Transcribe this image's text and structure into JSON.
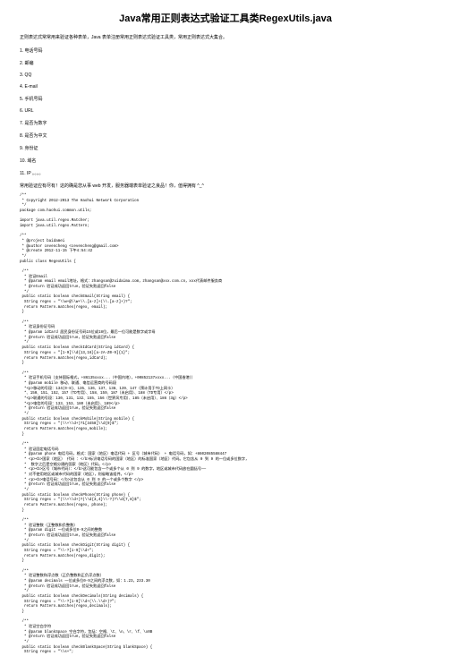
{
  "title": "Java常用正则表达式验证工具类RegexUtils.java",
  "intro": "正则表达式常常用来验证各种表单，Java 表单注册常用正则表达式验证工具类，常用正则表达式大集合。",
  "list": [
    "1. 电话号码",
    "2. 邮编",
    "3. QQ",
    "4. E-mail",
    "5. 手机号码",
    "6. URL",
    "7. 是否为数字",
    "8. 是否为中文",
    "9. 身份证",
    "10. 域名",
    "11. IP 。。。。"
  ],
  "note": "常用验证应有尽有！这的确是您从事 web 开发，服务器端表单验证之良品！你，值得拥有 ^_^",
  "code": "/**\n * Copyright 2012-2013 The Haohui Network Corporation\n */\npackage com.haohui.common.utils;\n\nimport java.util.regex.Matcher;\nimport java.util.regex.Pattern;\n\n/**\n * @project baidamei\n * @author cevencheng <cevencheng@gmail.com>\n * @create 2012-11-15 下午4:54:42\n */\npublic class RegexUtils {\n\n /**\n  * 验证Email\n  * @param email email地址，格式：zhangsan@zuidaima.com，zhangsan@xxx.com.cn，xxx代表邮件服务商\n  * @return 验证成功返回true，验证失败返回false\n  */\n public static boolean checkEmail(String email) {\n  String regex = \"\\\\w+@\\\\w+\\\\.[a-z]+(\\\\.[a-z]+)?\";\n  return Pattern.matches(regex, email);\n }\n\n /**\n  * 验证身份证号码\n  * @param idCard 居民身份证号码15位或18位，最后一位可能是数字或字母\n  * @return 验证成功返回true，验证失败返回false\n  */\n public static boolean checkIdCard(String idCard) {\n  String regex = \"[1-9]\\\\d{13,16}[a-zA-Z0-9]{1}\";\n  return Pattern.matches(regex,idCard);\n }\n\n /**\n  * 验证手机号码（支持国际格式，+86135xxxx...（中国内地），+00852137xxxx...（中国香港））\n  * @param mobile 移动、联通、电信运营商的号码段\n  *<p>移动的号段：134(0-8)、135、136、137、138、139、147（预计用于TD上网卡）\n  *、150、151、152、157（TD专用）、158、159、187（未启用）、188（TD专用）</p>\n  *<p>联通的号段：130、131、132、155、156（世界风专用）、185（未启用）、186（3g）</p>\n  *<p>电信的号段：133、153、180（未启用）、189</p>\n  * @return 验证成功返回true，验证失败返回false\n  */\n public static boolean checkMobile(String mobile) {\n  String regex = \"(\\\\+\\\\d+)?1[3458]\\\\d{9}$\";\n  return Pattern.matches(regex,mobile);\n }\n\n /**\n  * 验证固定电话号码\n  * @param phone 电话号码，格式：国家（地区）电话代码 + 区号（城市代码） + 电话号码，如：+8602085588447\n  * <p><b>国家（地区） 代码 ：</b>标识电话号码的国家（地区）的标准国家（地区）代码。它包含从 0 到 9 的一位或多位数字，\n  *  数字之后是空格分隔的国家（地区）代码。</p>\n  * <p><b>区号（城市代码）：</b>这可能包含一个或多个从 0 到 9 的数字，地区或城市代码放在圆括号——\n  * 对不使用地区或城市代码的国家（地区），则省略该组件。</p>\n  * <p><b>电话号码：</b>这包含从 0 到 9 的一个或多个数字 </p>\n  * @return 验证成功返回true，验证失败返回false\n  */\n public static boolean checkPhone(String phone) {\n  String regex = \"(\\\\+\\\\d+)?(\\\\d{3,4}\\\\-?)?\\\\d{7,8}$\";\n  return Pattern.matches(regex, phone);\n }\n\n /**\n  * 验证整数（正整数和负整数）\n  * @param digit 一位或多位0-9之间的整数\n  * @return 验证成功返回true，验证失败返回false\n  */\n public static boolean checkDigit(String digit) {\n  String regex = \"\\\\-?[1-9]\\\\d+\";\n  return Pattern.matches(regex,digit);\n }\n\n /**\n  * 验证整数和浮点数（正负整数和正负浮点数）\n  * @param decimals 一位或多位0-9之间的浮点数，如：1.23，233.30\n  * @return 验证成功返回true，验证失败返回false\n  */\n public static boolean checkDecimals(String decimals) {\n  String regex = \"\\\\-?[1-9]\\\\d+(\\\\.\\\\d+)?\";\n  return Pattern.matches(regex,decimals);\n }\n\n /**\n  * 验证空白字符\n  * @param blankSpace 空白字符，包括：空格、\\t、\\n、\\r、\\f、\\x0B\n  * @return 验证成功返回true，验证失败返回false\n  */\n public static boolean checkBlankSpace(String blankSpace) {\n  String regex = \"\\\\s+\";"
}
